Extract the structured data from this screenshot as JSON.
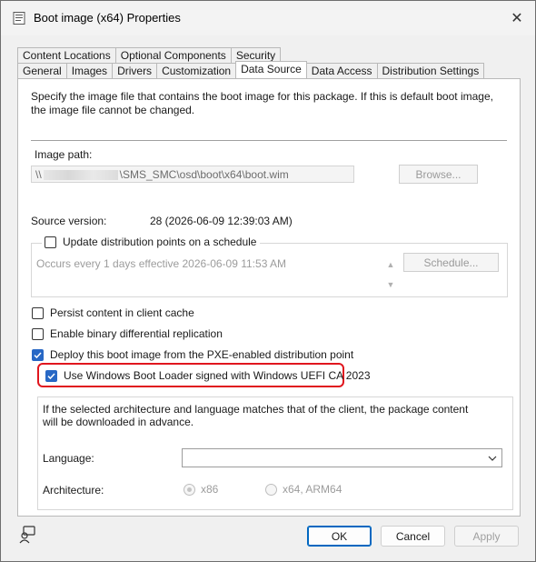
{
  "window": {
    "title": "Boot image (x64) Properties",
    "close_glyph": "✕"
  },
  "tabs": {
    "row_back": [
      "Content Locations",
      "Optional Components",
      "Security"
    ],
    "row_front": [
      "General",
      "Images",
      "Drivers",
      "Customization",
      "Data Source",
      "Data Access",
      "Distribution Settings"
    ],
    "active": "Data Source"
  },
  "data_source": {
    "description": "Specify the image file that contains the boot image for this package. If this is default boot image, the image file cannot be changed.",
    "image_path_label": "Image path:",
    "image_path_prefix": "\\\\",
    "image_path_suffix": "\\SMS_SMC\\osd\\boot\\x64\\boot.wim",
    "browse_label": "Browse...",
    "source_version_label": "Source version:",
    "source_version_value": "28 (2026-06-09 12:39:03 AM)",
    "schedule_group": {
      "label": "Update distribution points on a schedule",
      "checked": false,
      "schedule_text": "Occurs every 1 days effective 2026-06-09 11:53 AM",
      "schedule_button": "Schedule..."
    },
    "options": [
      {
        "label": "Persist content in client cache",
        "checked": false
      },
      {
        "label": "Enable binary differential replication",
        "checked": false
      },
      {
        "label": "Deploy this boot image from the PXE-enabled distribution point",
        "checked": true
      }
    ],
    "uefi_option": {
      "label": "Use Windows Boot Loader signed with Windows UEFI CA 2023",
      "checked": true
    },
    "arch_group": {
      "description": "If the selected architecture and language matches that of the client, the package content will be downloaded in advance.",
      "language_label": "Language:",
      "language_value": "",
      "architecture_label": "Architecture:",
      "arch_options": [
        {
          "label": "x86",
          "selected": true
        },
        {
          "label": "x64, ARM64",
          "selected": false
        }
      ]
    }
  },
  "footer": {
    "ok": "OK",
    "cancel": "Cancel",
    "apply": "Apply"
  },
  "colors": {
    "accent": "#2868c5",
    "highlight_red": "#e0161e",
    "primary_border": "#0067c0"
  }
}
